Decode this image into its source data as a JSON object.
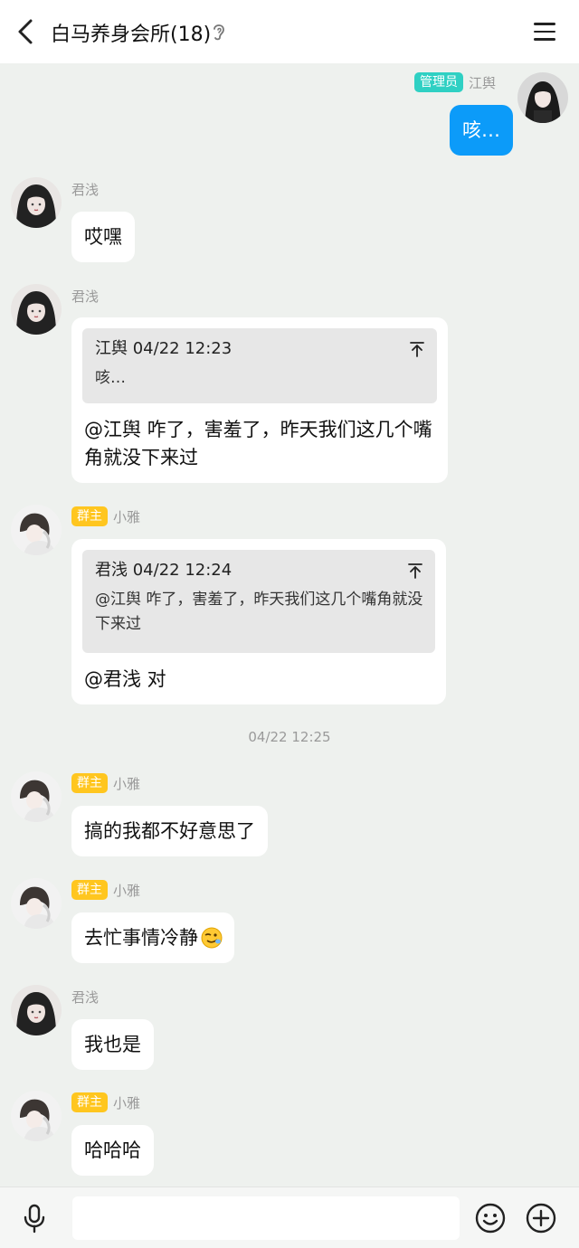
{
  "header": {
    "title": "白马养身会所(18)"
  },
  "messages": {
    "m1": {
      "sender": "江舆",
      "badge": "管理员",
      "text": "咳…"
    },
    "m2": {
      "sender": "君浅",
      "text": "哎嘿"
    },
    "m3": {
      "sender": "君浅",
      "quote_head": "江舆 04/22 12:23",
      "quote_body": "咳…",
      "text": "@江舆 咋了，害羞了，昨天我们这几个嘴角就没下来过"
    },
    "m4": {
      "sender": "小雅",
      "badge": "群主",
      "quote_head": "君浅 04/22 12:24",
      "quote_body": "@江舆 咋了，害羞了，昨天我们这几个嘴角就没下来过",
      "text": "@君浅 对"
    },
    "ts": "04/22 12:25",
    "m5": {
      "sender": "小雅",
      "badge": "群主",
      "text": "搞的我都不好意思了"
    },
    "m6": {
      "sender": "小雅",
      "badge": "群主",
      "text": "去忙事情冷静"
    },
    "m7": {
      "sender": "君浅",
      "text": "我也是"
    },
    "m8": {
      "sender": "小雅",
      "badge": "群主",
      "text": "哈哈哈"
    }
  },
  "icons": {
    "back": "chevron-left-icon",
    "ear": "ear-icon",
    "menu": "hamburger-menu-icon",
    "quote_top": "arrow-up-to-top-icon",
    "mic": "microphone-icon",
    "emoji": "smiley-icon",
    "plus": "plus-circle-icon",
    "wink_emoji": "wink-emoji-icon"
  },
  "colors": {
    "self_bubble": "#0c9bf9",
    "admin_badge": "#2fd0c3",
    "owner_badge": "#ffc61f",
    "chat_background": "#eef1ee"
  },
  "input": {
    "value": ""
  }
}
